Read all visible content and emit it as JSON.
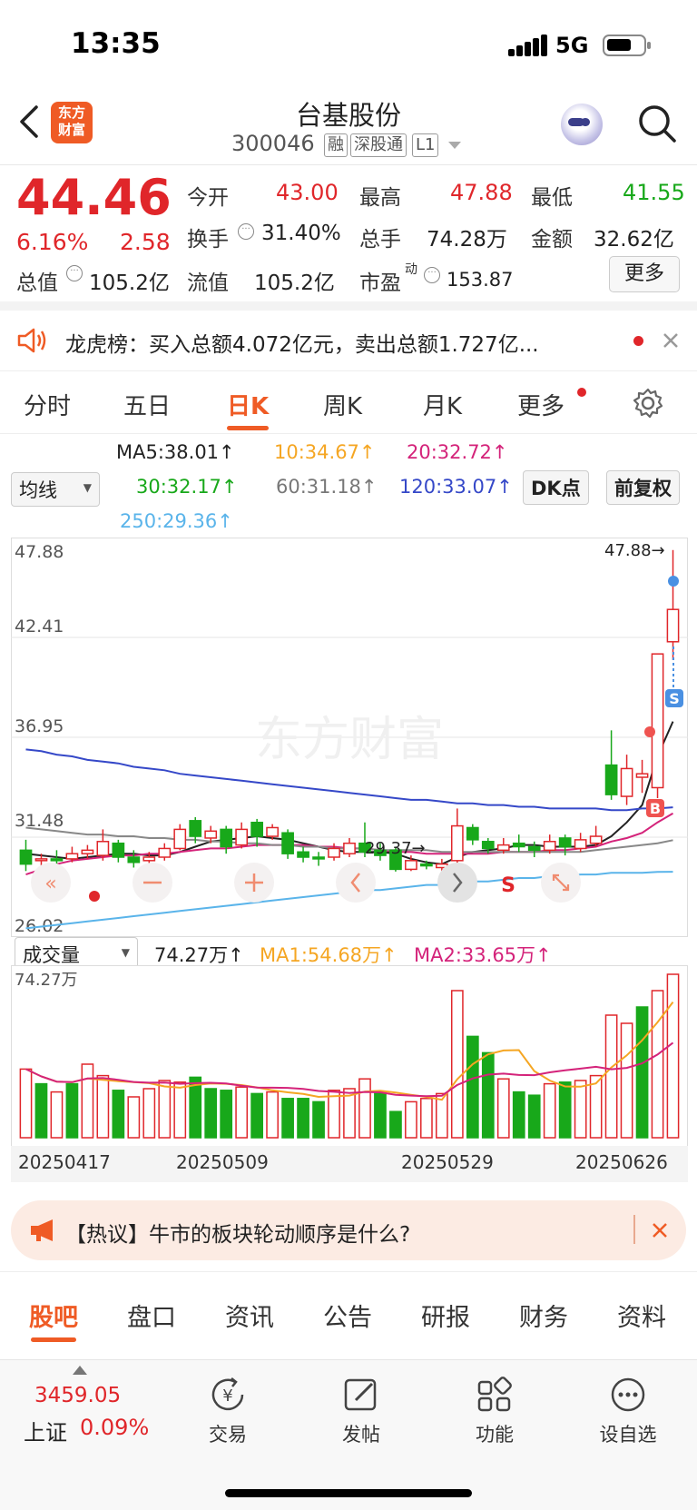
{
  "status": {
    "time": "13:35",
    "network": "5G"
  },
  "header": {
    "name": "台基股份",
    "code": "300046",
    "tags": [
      "融",
      "深股通",
      "L1"
    ],
    "logo_text": [
      "东方",
      "财富"
    ]
  },
  "quote": {
    "price": "44.46",
    "change_pct": "6.16%",
    "change": "2.58",
    "open_label": "今开",
    "open": "43.00",
    "high_label": "最高",
    "high": "47.88",
    "low_label": "最低",
    "low": "41.55",
    "turnover_label": "换手",
    "turnover": "31.40%",
    "volume_label": "总手",
    "volume": "74.28万",
    "amount_label": "金额",
    "amount": "32.62亿",
    "mktcap_label": "总值",
    "mktcap": "105.2亿",
    "float_label": "流值",
    "float": "105.2亿",
    "pe_label": "市盈",
    "pe_sup": "动",
    "pe": "153.87",
    "more": "更多"
  },
  "notice": {
    "text": "龙虎榜：买入总额4.072亿元，卖出总额1.727亿..."
  },
  "tabs": [
    "分时",
    "五日",
    "日K",
    "周K",
    "月K",
    "更多"
  ],
  "active_tab": "日K",
  "ma": {
    "selector": "均线",
    "ma5": "MA5:38.01↑",
    "ma10": "10:34.67↑",
    "ma20": "20:32.72↑",
    "ma30": "30:32.17↑",
    "ma60": "60:31.18↑",
    "ma120": "120:33.07↑",
    "ma250": "250:29.36↑",
    "dk": "DK点",
    "fq": "前复权"
  },
  "chart_data": {
    "type": "candlestick",
    "price_axis": [
      "47.88",
      "42.41",
      "36.95",
      "31.48",
      "26.02"
    ],
    "high_marker": "47.88→",
    "low_marker": "29.37→",
    "watermark": "东方财富",
    "candles": [
      {
        "o": 30.6,
        "c": 29.8,
        "h": 31.2,
        "l": 29.4
      },
      {
        "o": 30.0,
        "c": 30.1,
        "h": 30.4,
        "l": 29.6
      },
      {
        "o": 30.1,
        "c": 30.0,
        "h": 30.6,
        "l": 29.7
      },
      {
        "o": 30.1,
        "c": 30.4,
        "h": 30.8,
        "l": 29.9
      },
      {
        "o": 30.4,
        "c": 30.6,
        "h": 30.9,
        "l": 30.1
      },
      {
        "o": 30.3,
        "c": 31.1,
        "h": 31.8,
        "l": 30.0
      },
      {
        "o": 31.0,
        "c": 30.2,
        "h": 31.2,
        "l": 29.9
      },
      {
        "o": 30.2,
        "c": 29.9,
        "h": 30.6,
        "l": 29.6
      },
      {
        "o": 30.0,
        "c": 30.2,
        "h": 30.5,
        "l": 29.8
      },
      {
        "o": 30.2,
        "c": 30.7,
        "h": 31.0,
        "l": 30.0
      },
      {
        "o": 30.7,
        "c": 31.8,
        "h": 32.1,
        "l": 30.6
      },
      {
        "o": 32.3,
        "c": 31.4,
        "h": 32.5,
        "l": 31.0
      },
      {
        "o": 31.3,
        "c": 31.7,
        "h": 32.0,
        "l": 31.0
      },
      {
        "o": 31.8,
        "c": 30.8,
        "h": 32.0,
        "l": 30.4
      },
      {
        "o": 30.9,
        "c": 31.8,
        "h": 32.2,
        "l": 30.7
      },
      {
        "o": 32.2,
        "c": 31.4,
        "h": 32.4,
        "l": 30.8
      },
      {
        "o": 31.4,
        "c": 31.9,
        "h": 32.1,
        "l": 31.2
      },
      {
        "o": 31.6,
        "c": 30.4,
        "h": 31.8,
        "l": 30.1
      },
      {
        "o": 30.5,
        "c": 30.2,
        "h": 30.8,
        "l": 29.9
      },
      {
        "o": 30.2,
        "c": 30.1,
        "h": 30.5,
        "l": 29.7
      },
      {
        "o": 30.2,
        "c": 30.7,
        "h": 31.0,
        "l": 30.0
      },
      {
        "o": 30.4,
        "c": 31.0,
        "h": 31.3,
        "l": 30.2
      },
      {
        "o": 31.0,
        "c": 30.5,
        "h": 32.2,
        "l": 30.2
      },
      {
        "o": 30.6,
        "c": 30.3,
        "h": 31.0,
        "l": 30.0
      },
      {
        "o": 30.6,
        "c": 29.5,
        "h": 30.8,
        "l": 29.37
      },
      {
        "o": 29.5,
        "c": 30.0,
        "h": 30.3,
        "l": 29.4
      },
      {
        "o": 29.8,
        "c": 29.7,
        "h": 30.0,
        "l": 29.5
      },
      {
        "o": 29.6,
        "c": 29.8,
        "h": 30.1,
        "l": 29.4
      },
      {
        "o": 30.0,
        "c": 32.0,
        "h": 33.0,
        "l": 29.8
      },
      {
        "o": 31.9,
        "c": 31.2,
        "h": 32.1,
        "l": 30.9
      },
      {
        "o": 31.1,
        "c": 30.7,
        "h": 31.3,
        "l": 30.4
      },
      {
        "o": 30.6,
        "c": 30.9,
        "h": 31.3,
        "l": 30.4
      },
      {
        "o": 31.0,
        "c": 30.8,
        "h": 31.5,
        "l": 30.5
      },
      {
        "o": 30.8,
        "c": 30.6,
        "h": 31.1,
        "l": 30.2
      },
      {
        "o": 30.6,
        "c": 31.1,
        "h": 31.5,
        "l": 30.4
      },
      {
        "o": 31.3,
        "c": 30.8,
        "h": 31.5,
        "l": 30.3
      },
      {
        "o": 30.7,
        "c": 31.2,
        "h": 31.6,
        "l": 30.5
      },
      {
        "o": 31.0,
        "c": 31.4,
        "h": 32.0,
        "l": 30.8
      },
      {
        "o": 35.5,
        "c": 33.8,
        "h": 37.5,
        "l": 33.5
      },
      {
        "o": 33.7,
        "c": 35.3,
        "h": 36.1,
        "l": 33.2
      },
      {
        "o": 34.8,
        "c": 35.0,
        "h": 35.8,
        "l": 33.9
      },
      {
        "o": 34.2,
        "c": 41.9,
        "h": 41.9,
        "l": 33.6
      },
      {
        "o": 42.6,
        "c": 44.46,
        "h": 47.88,
        "l": 41.55
      }
    ],
    "ma_series": {
      "ma5": [
        30.4,
        30.3,
        30.2,
        30.1,
        30.2,
        30.3,
        30.4,
        30.4,
        30.3,
        30.3,
        30.5,
        30.8,
        31.1,
        31.2,
        31.3,
        31.4,
        31.3,
        31.2,
        31.0,
        30.8,
        30.6,
        30.5,
        30.5,
        30.5,
        30.4,
        30.1,
        29.9,
        29.8,
        30.2,
        30.5,
        30.6,
        30.7,
        30.9,
        30.9,
        30.8,
        30.8,
        30.8,
        30.9,
        31.4,
        32.2,
        33.2,
        36.0,
        38.01
      ],
      "ma20": [
        29.2,
        29.5,
        29.8,
        30.0,
        30.1,
        30.2,
        30.3,
        30.3,
        30.4,
        30.4,
        30.5,
        30.6,
        30.7,
        30.7,
        30.8,
        30.9,
        30.9,
        30.9,
        30.9,
        30.8,
        30.8,
        30.7,
        30.7,
        30.6,
        30.5,
        30.5,
        30.4,
        30.4,
        30.4,
        30.4,
        30.4,
        30.5,
        30.5,
        30.5,
        30.6,
        30.6,
        30.7,
        30.8,
        31.1,
        31.3,
        31.6,
        32.2,
        32.72
      ],
      "ma60": [
        31.9,
        31.8,
        31.7,
        31.6,
        31.5,
        31.5,
        31.4,
        31.4,
        31.3,
        31.3,
        31.2,
        31.2,
        31.1,
        31.1,
        31.0,
        31.0,
        30.9,
        30.9,
        30.8,
        30.8,
        30.7,
        30.7,
        30.7,
        30.6,
        30.6,
        30.6,
        30.6,
        30.5,
        30.5,
        30.5,
        30.5,
        30.5,
        30.5,
        30.5,
        30.5,
        30.5,
        30.5,
        30.6,
        30.7,
        30.8,
        30.9,
        31.0,
        31.18
      ],
      "ma120": [
        36.4,
        36.3,
        36.1,
        36.0,
        35.8,
        35.7,
        35.6,
        35.4,
        35.3,
        35.2,
        35.0,
        34.9,
        34.8,
        34.7,
        34.6,
        34.5,
        34.4,
        34.3,
        34.2,
        34.1,
        34.0,
        33.9,
        33.8,
        33.7,
        33.6,
        33.5,
        33.5,
        33.4,
        33.3,
        33.3,
        33.2,
        33.2,
        33.1,
        33.1,
        33.0,
        33.0,
        33.0,
        33.0,
        32.9,
        32.9,
        33.0,
        33.0,
        33.07
      ],
      "ma250": [
        26.1,
        26.2,
        26.3,
        26.4,
        26.5,
        26.6,
        26.7,
        26.8,
        26.9,
        27.0,
        27.1,
        27.2,
        27.3,
        27.4,
        27.5,
        27.6,
        27.7,
        27.8,
        27.9,
        28.0,
        28.1,
        28.2,
        28.3,
        28.3,
        28.4,
        28.5,
        28.6,
        28.6,
        28.7,
        28.8,
        28.8,
        28.9,
        29.0,
        29.0,
        29.1,
        29.1,
        29.2,
        29.2,
        29.3,
        29.3,
        29.3,
        29.35,
        29.36
      ]
    },
    "volume": [
      42,
      33,
      28,
      33,
      45,
      38,
      29,
      25,
      30,
      35,
      34,
      37,
      30,
      29,
      31,
      27,
      28,
      24,
      24,
      22,
      29,
      30,
      36,
      27,
      16,
      22,
      24,
      27,
      90,
      62,
      52,
      36,
      28,
      26,
      33,
      34,
      35,
      38,
      75,
      70,
      80,
      90,
      100
    ],
    "volume_up": [
      true,
      false,
      true,
      false,
      true,
      true,
      false,
      true,
      true,
      true,
      true,
      false,
      false,
      false,
      true,
      false,
      true,
      false,
      false,
      false,
      true,
      true,
      true,
      false,
      false,
      true,
      true,
      true,
      true,
      false,
      false,
      true,
      false,
      false,
      true,
      false,
      true,
      true,
      true,
      true,
      false,
      true,
      true
    ]
  },
  "vol": {
    "selector": "成交量",
    "value": "74.27万↑",
    "ma1": "MA1:54.68万↑",
    "ma2": "MA2:33.65万↑",
    "axis_top": "74.27万"
  },
  "dates": [
    "20250417",
    "20250509",
    "20250529",
    "20250626"
  ],
  "hot": {
    "text": "【热议】牛市的板块轮动顺序是什么?"
  },
  "bottom_tabs": [
    "股吧",
    "盘口",
    "资讯",
    "公告",
    "研报",
    "财务",
    "资料"
  ],
  "index": {
    "value": "3459.05",
    "name": "上证",
    "pct": "0.09%"
  },
  "nav": [
    "交易",
    "发帖",
    "功能",
    "设自选"
  ],
  "colors": {
    "up": "#e0262a",
    "down": "#18a81a",
    "accent": "#ef5b25"
  }
}
